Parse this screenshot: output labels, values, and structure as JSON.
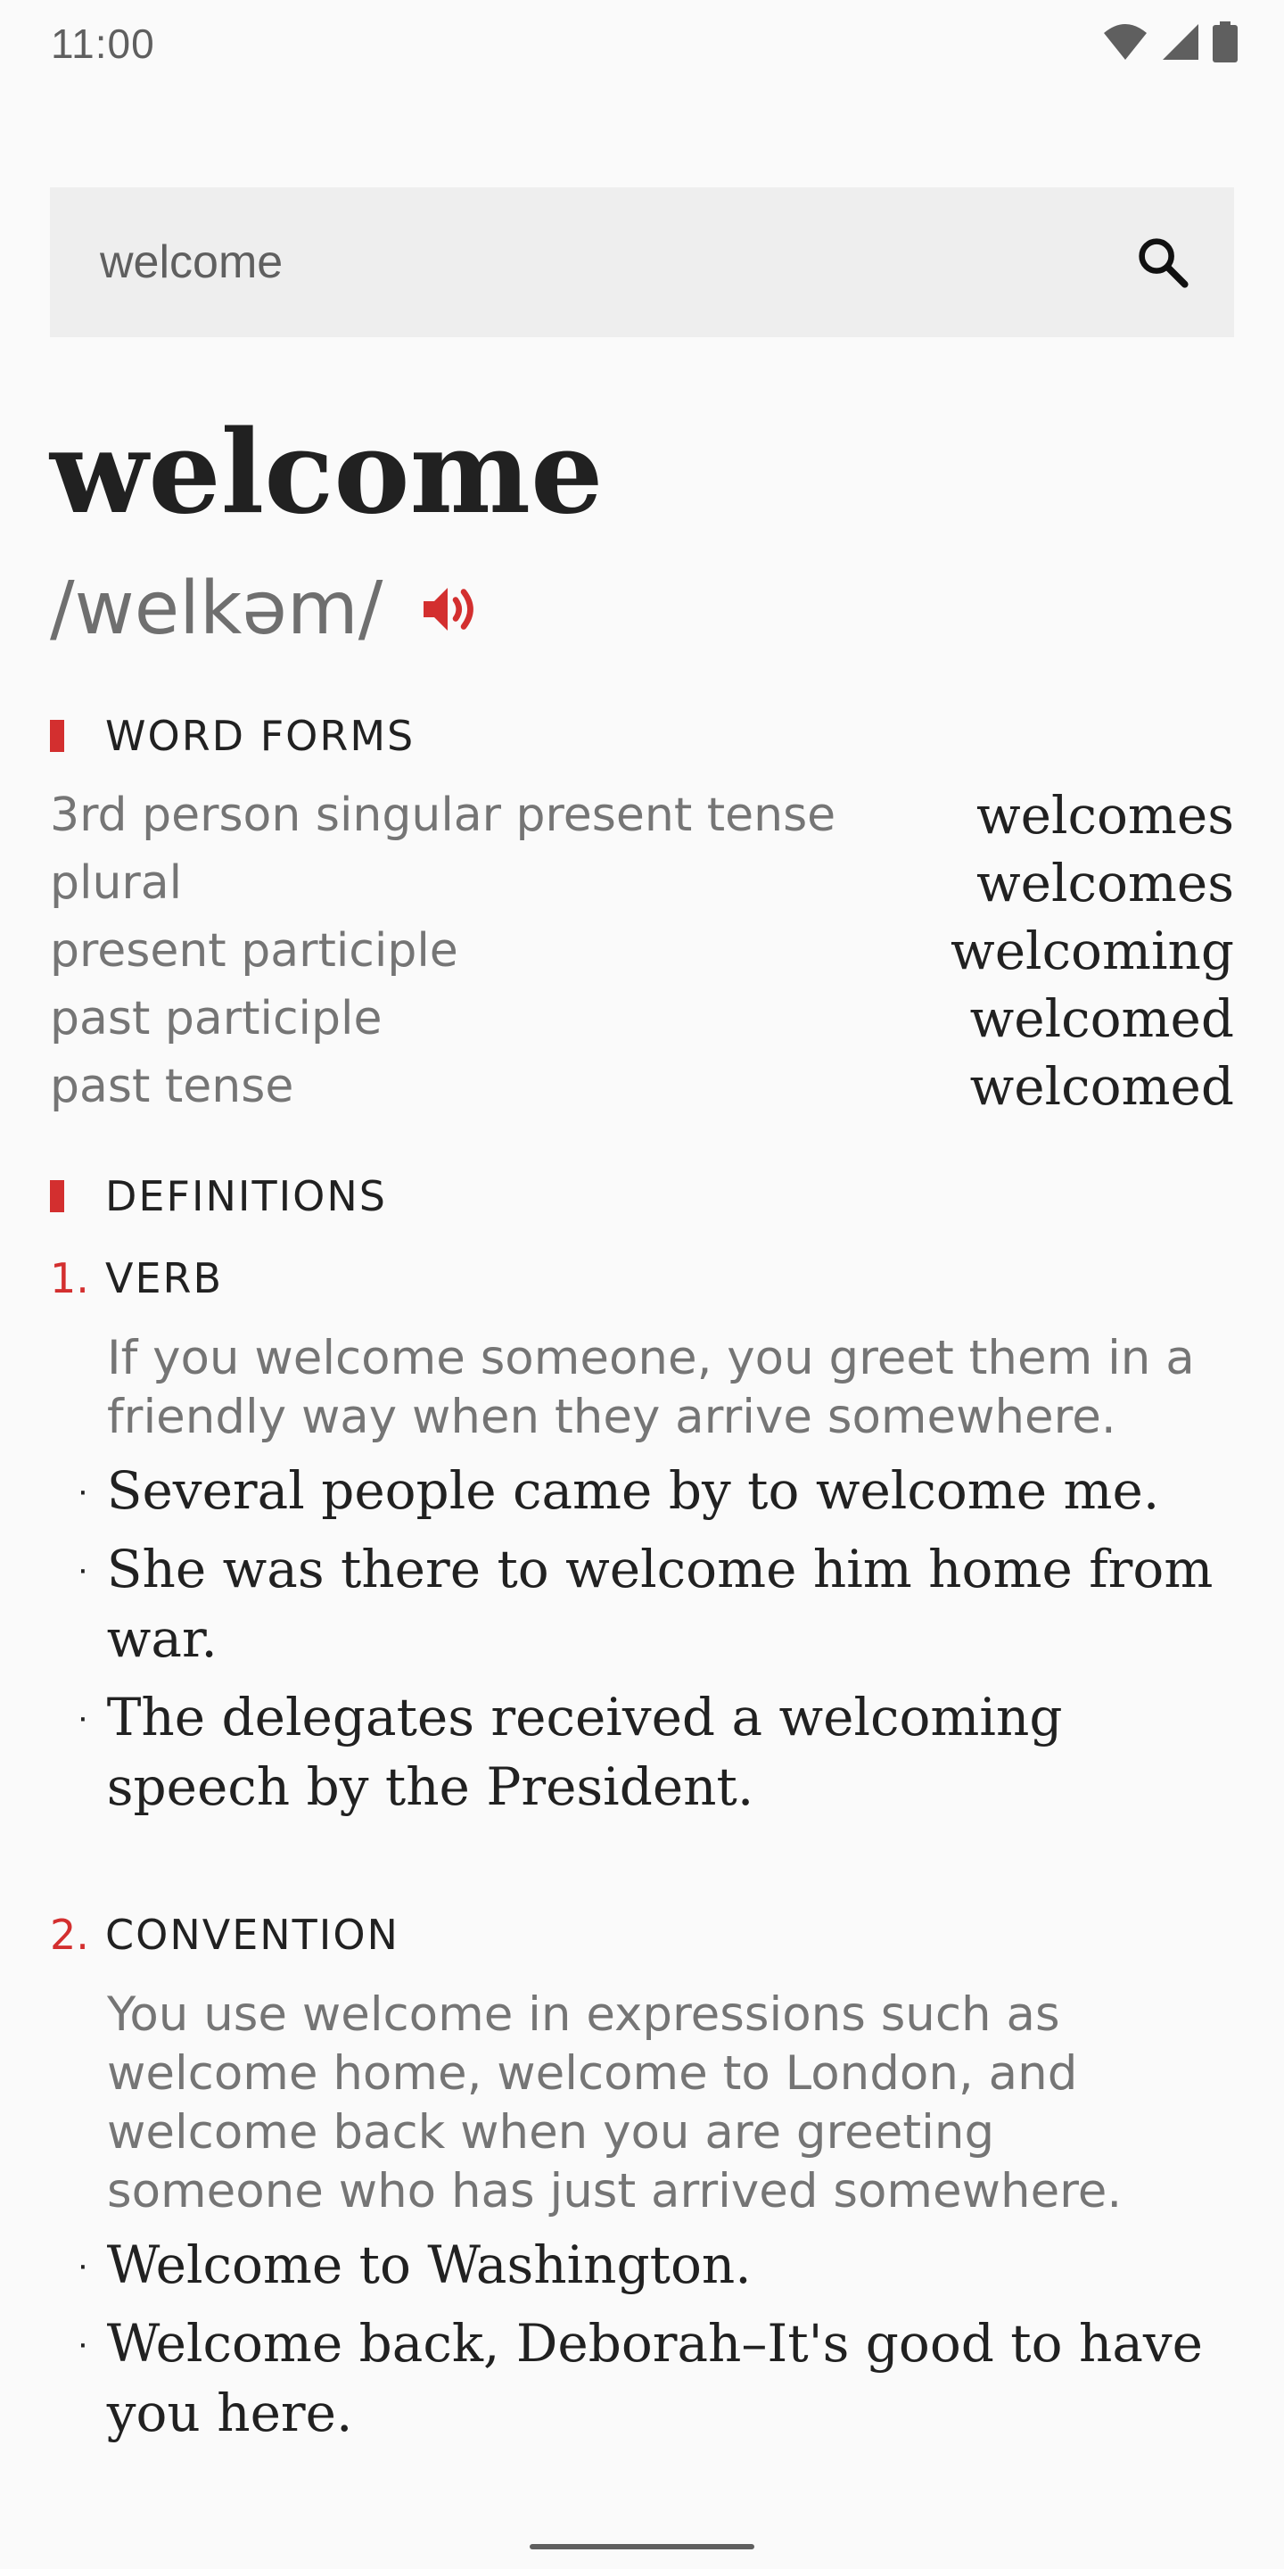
{
  "status": {
    "time": "11:00"
  },
  "search": {
    "value": "welcome",
    "placeholder": ""
  },
  "entry": {
    "headword": "welcome",
    "pronunciation": "/welkəm/"
  },
  "word_forms": {
    "title": "WORD FORMS",
    "items": [
      {
        "label": "3rd person singular present tense",
        "value": "welcomes"
      },
      {
        "label": "plural",
        "value": "welcomes"
      },
      {
        "label": "present participle",
        "value": "welcoming"
      },
      {
        "label": "past participle",
        "value": "welcomed"
      },
      {
        "label": "past tense",
        "value": "welcomed"
      }
    ]
  },
  "definitions": {
    "title": "DEFINITIONS",
    "senses": [
      {
        "number": "1.",
        "pos": "VERB",
        "definition": "If you welcome someone, you greet them in a friendly way when they arrive somewhere.",
        "examples": [
          "Several people came by to welcome me.",
          "She was there to welcome him home from war.",
          "The delegates received a welcoming speech by the President."
        ]
      },
      {
        "number": "2.",
        "pos": "CONVENTION",
        "definition": "You use welcome in expressions such as welcome home, welcome to London, and welcome back when you are greeting someone who has just arrived somewhere.",
        "examples": [
          "Welcome to Washington.",
          "Welcome back, Deborah–It's good to have you here."
        ]
      }
    ]
  },
  "colors": {
    "accent": "#d32f2f",
    "search_bg": "#eeeeee",
    "background": "#fafafa"
  },
  "icons": [
    "wifi-icon",
    "signal-icon",
    "battery-icon",
    "search-icon",
    "speaker-icon"
  ]
}
